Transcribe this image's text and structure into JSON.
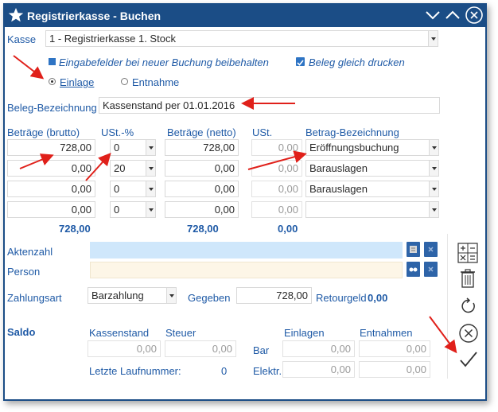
{
  "window": {
    "title": "Registrierkasse - Buchen"
  },
  "kasse": {
    "label": "Kasse",
    "value": "1 - Registrierkasse 1. Stock"
  },
  "options": {
    "keep_fields": "Eingabefelder bei neuer Buchung beibehalten",
    "print_receipt": "Beleg gleich drucken"
  },
  "mode": {
    "einlage": "Einlage",
    "entnahme": "Entnahme",
    "selected": "Einlage"
  },
  "beleg": {
    "label": "Beleg-Bezeichnung",
    "value": "Kassenstand per 01.01.2016"
  },
  "table": {
    "headers": {
      "brutto": "Beträge (brutto)",
      "ust_pct": "USt.-%",
      "netto": "Beträge (netto)",
      "ust": "USt.",
      "bez": "Betrag-Bezeichnung"
    },
    "rows": [
      {
        "brutto": "728,00",
        "ust_pct": "0",
        "netto": "728,00",
        "ust": "0,00",
        "bez": "Eröffnungsbuchung"
      },
      {
        "brutto": "0,00",
        "ust_pct": "20",
        "netto": "0,00",
        "ust": "0,00",
        "bez": "Barauslagen"
      },
      {
        "brutto": "0,00",
        "ust_pct": "0",
        "netto": "0,00",
        "ust": "0,00",
        "bez": "Barauslagen"
      },
      {
        "brutto": "0,00",
        "ust_pct": "0",
        "netto": "0,00",
        "ust": "0,00",
        "bez": ""
      }
    ],
    "totals": {
      "brutto": "728,00",
      "netto": "728,00",
      "ust": "0,00"
    }
  },
  "aktenzahl": {
    "label": "Aktenzahl",
    "value": ""
  },
  "person": {
    "label": "Person",
    "value": ""
  },
  "payment": {
    "label": "Zahlungsart",
    "value": "Barzahlung",
    "given_label": "Gegeben",
    "given_value": "728,00",
    "change_label": "Retourgeld",
    "change_value": "0,00"
  },
  "saldo": {
    "label": "Saldo",
    "kassenstand_label": "Kassenstand",
    "kassenstand_value": "0,00",
    "steuer_label": "Steuer",
    "steuer_value": "0,00",
    "einlagen_label": "Einlagen",
    "entnahmen_label": "Entnahmen",
    "bar_label": "Bar",
    "bar_einlagen": "0,00",
    "bar_entnahmen": "0,00",
    "elektr_label": "Elektr.",
    "elektr_einlagen": "0,00",
    "elektr_entnahmen": "0,00",
    "laufnummer_label": "Letzte Laufnummer:",
    "laufnummer_value": "0"
  },
  "colors": {
    "titlebar": "#1b4d86",
    "label": "#1f5aa6",
    "annotation_arrow": "#e0201a"
  },
  "icons": {
    "title": "star-icon",
    "collapse": "chevron-down-icon",
    "expand": "chevron-up-icon",
    "close": "close-circle-icon",
    "calculator": "calculator-icon",
    "trash": "trash-icon",
    "refresh": "refresh-icon",
    "cancel": "cancel-circle-icon",
    "ok": "checkmark-icon"
  }
}
